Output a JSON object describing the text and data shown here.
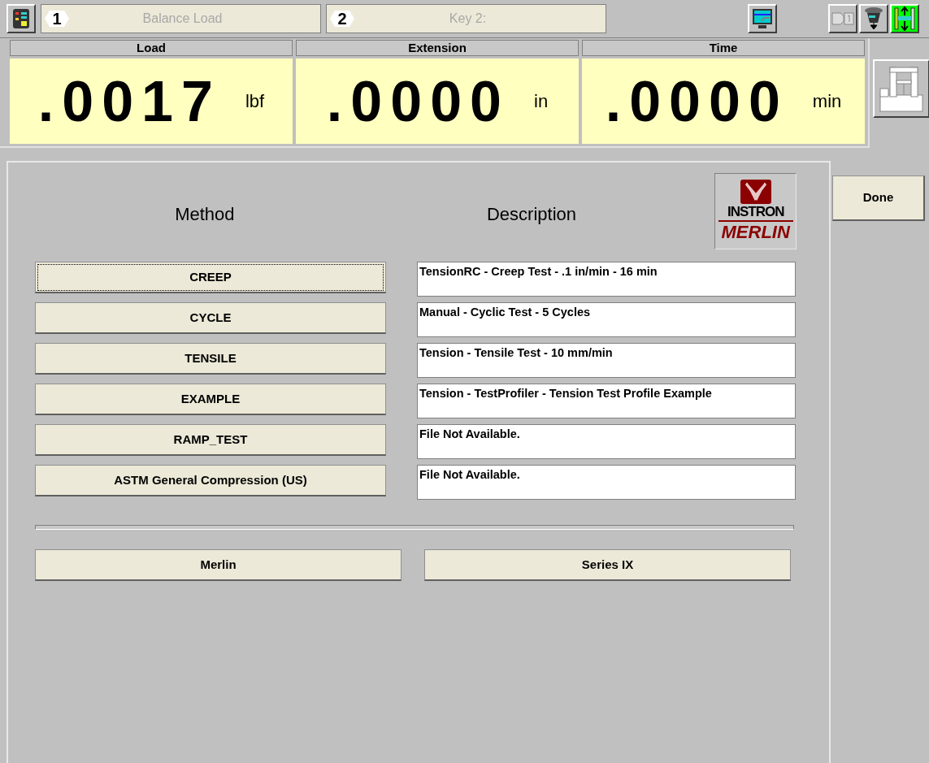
{
  "toolbar": {
    "keys": [
      {
        "number": "1",
        "label": "Balance Load",
        "disabled": true
      },
      {
        "number": "2",
        "label": "Key 2:",
        "disabled": true
      }
    ]
  },
  "readouts": [
    {
      "title": "Load",
      "value": ".0017",
      "unit": "lbf"
    },
    {
      "title": "Extension",
      "value": ".0000",
      "unit": "in"
    },
    {
      "title": "Time",
      "value": ".0000",
      "unit": "min"
    }
  ],
  "headings": {
    "method": "Method",
    "description": "Description"
  },
  "logo": {
    "top": "INSTRON",
    "bottom": "MERLIN"
  },
  "methods": [
    {
      "name": "CREEP",
      "description": "TensionRC - Creep Test - .1 in/min - 16 min",
      "selected": true
    },
    {
      "name": "CYCLE",
      "description": "Manual - Cyclic Test -  5 Cycles",
      "selected": false
    },
    {
      "name": "TENSILE",
      "description": "Tension - Tensile Test - 10 mm/min",
      "selected": false
    },
    {
      "name": "EXAMPLE",
      "description": "Tension - TestProfiler - Tension Test Profile Example",
      "selected": false
    },
    {
      "name": "RAMP_TEST",
      "description": "File Not Available.",
      "selected": false
    },
    {
      "name": "ASTM General Compression (US)",
      "description": "File Not Available.",
      "selected": false
    }
  ],
  "families": [
    "Merlin",
    "Series IX"
  ],
  "done_button": "Done"
}
